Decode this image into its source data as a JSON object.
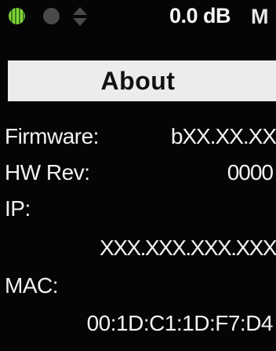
{
  "status_bar": {
    "indicator_left": "green-signal-dot",
    "indicator_mid": "grey-signal-dot",
    "indicator_arrows": "up-down-arrows",
    "level": "0.0 dB",
    "mode_letter": "M",
    "colors": {
      "signal_on": "#7ed43a",
      "signal_off": "#4a4a4a"
    }
  },
  "header": {
    "title": "About"
  },
  "info": {
    "firmware_label": "Firmware:",
    "firmware_value": "bXX.XX.XX",
    "hw_rev_label": "HW Rev:",
    "hw_rev_value": "0000",
    "ip_label": "IP:",
    "ip_value": "XXX.XXX.XXX.XXX",
    "mac_label": "MAC:",
    "mac_value": "00:1D:C1:1D:F7:D4"
  }
}
